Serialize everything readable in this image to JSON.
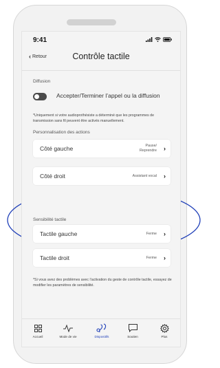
{
  "status_bar": {
    "time": "9:41"
  },
  "nav": {
    "back_label": "Retour",
    "title": "Contrôle tactile"
  },
  "diffusion": {
    "section_label": "Diffusion",
    "toggle_label": "Accepter/Terminer l’appel ou la diffusion",
    "toggle_on": false,
    "note": "*Uniquement si votre audioprothésiste a déterminé que les programmes de transmission sans fil peuvent être activés manuellement."
  },
  "actions": {
    "section_label": "Personnalisation des actions",
    "rows": [
      {
        "label": "Côté gauche",
        "value": "Pause/ Reprendre"
      },
      {
        "label": "Côté droit",
        "value": "Assistant vocal"
      }
    ]
  },
  "sensitivity": {
    "section_label": "Sensibilité tactile",
    "rows": [
      {
        "label": "Tactile gauche",
        "value": "Ferme"
      },
      {
        "label": "Tactile droit",
        "value": "Ferme"
      }
    ],
    "note": "*Si vous avez des problèmes avec l’activation du geste de contrôle tactile, essayez de modifier les paramètres de sensibilité."
  },
  "tab_bar": {
    "active_index": 2,
    "active_color": "#1f3fb8",
    "tabs": [
      {
        "label": "Accueil",
        "icon": "grid-icon"
      },
      {
        "label": "Mode de vie",
        "icon": "activity-icon"
      },
      {
        "label": "Dispositifs",
        "icon": "hearing-aids-icon"
      },
      {
        "label": "Soutien",
        "icon": "chat-icon"
      },
      {
        "label": "Plus",
        "icon": "gear-icon"
      }
    ]
  },
  "colors": {
    "accent": "#1f3fb8",
    "toggle_off": "#4a4a4a",
    "background": "#f4f4f4"
  }
}
